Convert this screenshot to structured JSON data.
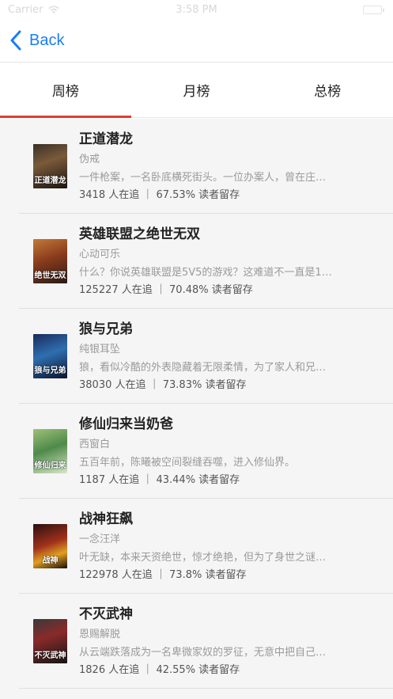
{
  "status_bar": {
    "carrier": "Carrier",
    "time": "3:58 PM"
  },
  "nav": {
    "back_label": "Back"
  },
  "tabs": [
    {
      "label": "周榜",
      "active": true
    },
    {
      "label": "月榜",
      "active": false
    },
    {
      "label": "总榜",
      "active": false
    }
  ],
  "books": [
    {
      "title": "正道潜龙",
      "author": "伪戒",
      "desc": "一件枪案，一名卧底横死街头。一位办案人，曾在庄…",
      "stats": "3418 人在追 ｜ 67.53% 读者留存",
      "cover_text": "正道潜龙"
    },
    {
      "title": "英雄联盟之绝世无双",
      "author": "心动可乐",
      "desc": "什么？你说英雄联盟是5V5的游戏？这难道不一直是1…",
      "stats": "125227 人在追 ｜ 70.48% 读者留存",
      "cover_text": "绝世无双"
    },
    {
      "title": "狼与兄弟",
      "author": "纯银耳坠",
      "desc": "狼，看似冷酷的外表隐藏着无限柔情，为了家人和兄…",
      "stats": "38030 人在追 ｜ 73.83% 读者留存",
      "cover_text": "狼与兄弟"
    },
    {
      "title": "修仙归来当奶爸",
      "author": "西窗白",
      "desc": "五百年前，陈曦被空间裂缝吞噬，进入修仙界。",
      "stats": "1187 人在追 ｜ 43.44% 读者留存",
      "cover_text": "修仙归来"
    },
    {
      "title": "战神狂飙",
      "author": "一念汪洋",
      "desc": "叶无缺，本来天资绝世，惊才绝艳，但为了身世之谜…",
      "stats": "122978 人在追 ｜ 73.8% 读者留存",
      "cover_text": "战神"
    },
    {
      "title": "不灭武神",
      "author": "恩赐解脱",
      "desc": "从云端跌落成为一名卑微家奴的罗征，无意中把自己…",
      "stats": "1826 人在追 ｜ 42.55% 读者留存",
      "cover_text": "不灭武神"
    }
  ],
  "colors": {
    "accent_blue": "#1a7ef5",
    "tab_indicator": "#e23b36",
    "list_bg": "#f5f5f5"
  }
}
